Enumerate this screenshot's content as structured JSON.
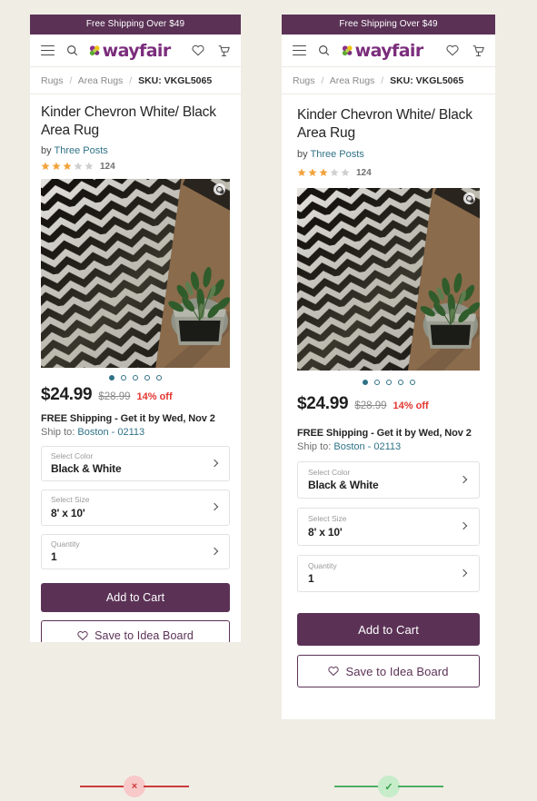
{
  "promo": {
    "text": "Free Shipping Over $49"
  },
  "nav": {
    "menu_icon": "hamburger-menu-icon",
    "search_icon": "search-icon",
    "logo_text": "wayfair",
    "logo_tm": "®",
    "wishlist_icon": "heart-icon",
    "cart_icon": "shopping-cart-icon"
  },
  "breadcrumb": {
    "level1": "Rugs",
    "level2": "Area Rugs",
    "sku": "SKU: VKGL5065",
    "separator": "/"
  },
  "product": {
    "title": "Kinder Chevron White/ Black Area Rug",
    "by_label": "by",
    "brand": "Three Posts",
    "stars_filled": 3,
    "stars_total": 5,
    "review_count": "124",
    "zoom_icon": "zoom-in-icon",
    "carousel_dots": 5,
    "carousel_active": 1
  },
  "price": {
    "current": "$24.99",
    "was": "$28.99",
    "discount": "14% off"
  },
  "shipping": {
    "line": "FREE Shipping - Get it by Wed, Nov 2",
    "ship_to_label": "Ship to:",
    "location": "Boston - 02113"
  },
  "options": [
    {
      "label": "Select Color",
      "value": "Black & White",
      "chevron": "chevron-right-icon"
    },
    {
      "label": "Select Size",
      "value": "8' x 10'",
      "chevron": "chevron-right-icon"
    },
    {
      "label": "Quantity",
      "value": "1",
      "chevron": "chevron-right-icon"
    }
  ],
  "actions": {
    "add_to_cart": "Add to Cart",
    "save_board": "Save to Idea Board",
    "save_icon": "heart-outline-icon"
  },
  "status": {
    "fail_symbol": "×",
    "pass_symbol": "✓",
    "fail_name": "fail-indicator",
    "pass_name": "pass-indicator"
  },
  "colors": {
    "brand_purple": "#5b3256",
    "logo_purple": "#7b2d7c",
    "link_teal": "#2f7287",
    "discount_red": "#e3342f",
    "star_orange": "#f2a33c",
    "star_grey": "#cfcfcf",
    "page_bg": "#f0ede5",
    "fail_red": "#cc3b3b",
    "pass_green": "#4caf63"
  }
}
